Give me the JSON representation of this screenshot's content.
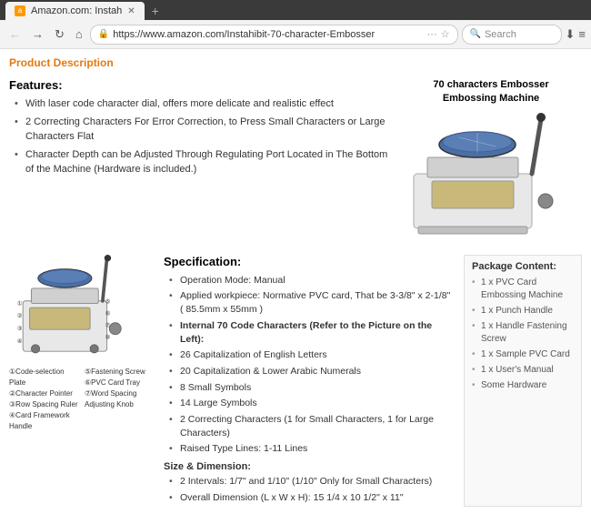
{
  "browser": {
    "tab_label": "Amazon.com: Instah",
    "url": "https://www.amazon.com/Instahibit-70-character-Embosser",
    "search_placeholder": "Search",
    "nav_back_label": "←",
    "nav_forward_label": "→",
    "nav_refresh_label": "↻",
    "nav_home_label": "⌂",
    "ssl_icon": "🔒",
    "dots_label": "···",
    "star_label": "★",
    "download_label": "⬇",
    "menu_label": "≡"
  },
  "page": {
    "product_description_label": "Product Description",
    "top_image_title_line1": "70 characters Embosser",
    "top_image_title_line2": "Embossing Machine",
    "features": {
      "title": "Features:",
      "items": [
        "With laser code character dial, offers more delicate and realistic effect",
        "2 Correcting Characters For Error Correction, to Press Small Characters or Large Characters Flat",
        "Character Depth can be Adjusted Through Regulating Port Located in The Bottom of the Machine (Hardware is included.)"
      ]
    },
    "specs": {
      "title": "Specification:",
      "items": [
        {
          "bold": false,
          "text": "Operation Mode: Manual"
        },
        {
          "bold": false,
          "text": "Applied workpiece: Normative PVC card, That be 3-3/8\" x 2-1/8\" ( 85.5mm x 55mm )"
        },
        {
          "bold": true,
          "text": "Internal 70 Code Characters (Refer to the Picture on the Left):"
        },
        {
          "bold": false,
          "text": "26 Capitalization of English Letters"
        },
        {
          "bold": false,
          "text": "20 Capitalization & Lower Arabic Numerals"
        },
        {
          "bold": false,
          "text": "8 Small Symbols"
        },
        {
          "bold": false,
          "text": "14 Large Symbols"
        },
        {
          "bold": false,
          "text": "2 Correcting Characters (1 for Small Characters, 1 for Large Characters)"
        },
        {
          "bold": false,
          "text": "Raised Type Lines: 1-11 Lines"
        }
      ],
      "subtitle": "Size & Dimension:",
      "dimension_items": [
        "2 Intervals: 1/7\" and 1/10\" (1/10\" Only for Small Characters)",
        "Overall Dimension (L x W x H): 15 1/4 x 10 1/2\" x 11\""
      ]
    },
    "package": {
      "title": "Package Content:",
      "items": [
        "1 x PVC Card Embossing Machine",
        "1 x Punch Handle",
        "1 x Handle Fastening Screw",
        "1 x Sample PVC Card",
        "1 x User's Manual",
        "Some Hardware"
      ]
    },
    "diagram_labels_left": [
      "①Code-selection Plate",
      "②Character Pointer",
      "③Row Spacing Ruler",
      "④Card Framework Handle"
    ],
    "diagram_labels_right": [
      "⑤Fastening Screw",
      "⑥PVC Card Tray",
      "⑦Word Spacing Adjusting Knob"
    ]
  }
}
